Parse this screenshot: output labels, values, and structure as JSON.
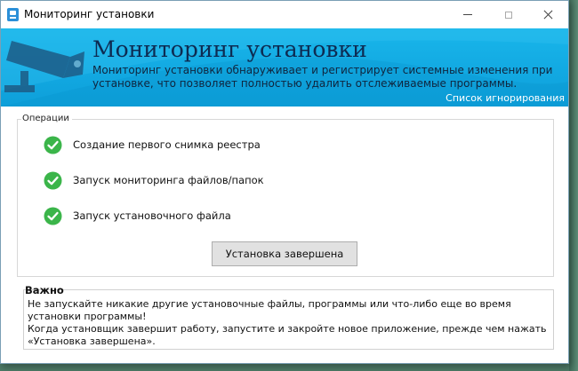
{
  "window": {
    "title": "Мониторинг установки"
  },
  "banner": {
    "title": "Мониторинг установки",
    "description": "Мониторинг установки обнаруживает и регистрирует системные изменения при установке, что позволяет полностью удалить отслеживаемые программы.",
    "ignore_link": "Список игнорирования"
  },
  "operations": {
    "legend": "Операции",
    "steps": [
      {
        "label": "Создание первого снимка реестра",
        "status": "done"
      },
      {
        "label": "Запуск мониторинга файлов/папок",
        "status": "done"
      },
      {
        "label": "Запуск установочного файла",
        "status": "done"
      }
    ],
    "done_button": "Установка завершена"
  },
  "important": {
    "title": "Важно",
    "line1": "Не запускайте никакие другие установочные файлы, программы или что-либо еще во время установки программы!",
    "line2": "Когда установщик завершит работу, запустите и закройте новое приложение, прежде чем нажать «Установка завершена»."
  },
  "icons": {
    "app": "app-monitor-icon",
    "banner": "security-camera-icon",
    "step": "check-circle-icon"
  },
  "colors": {
    "banner": "#12a9e2",
    "banner_title": "#0d2b52",
    "check": "#3bb54a",
    "button_bg": "#e1e1e1"
  }
}
